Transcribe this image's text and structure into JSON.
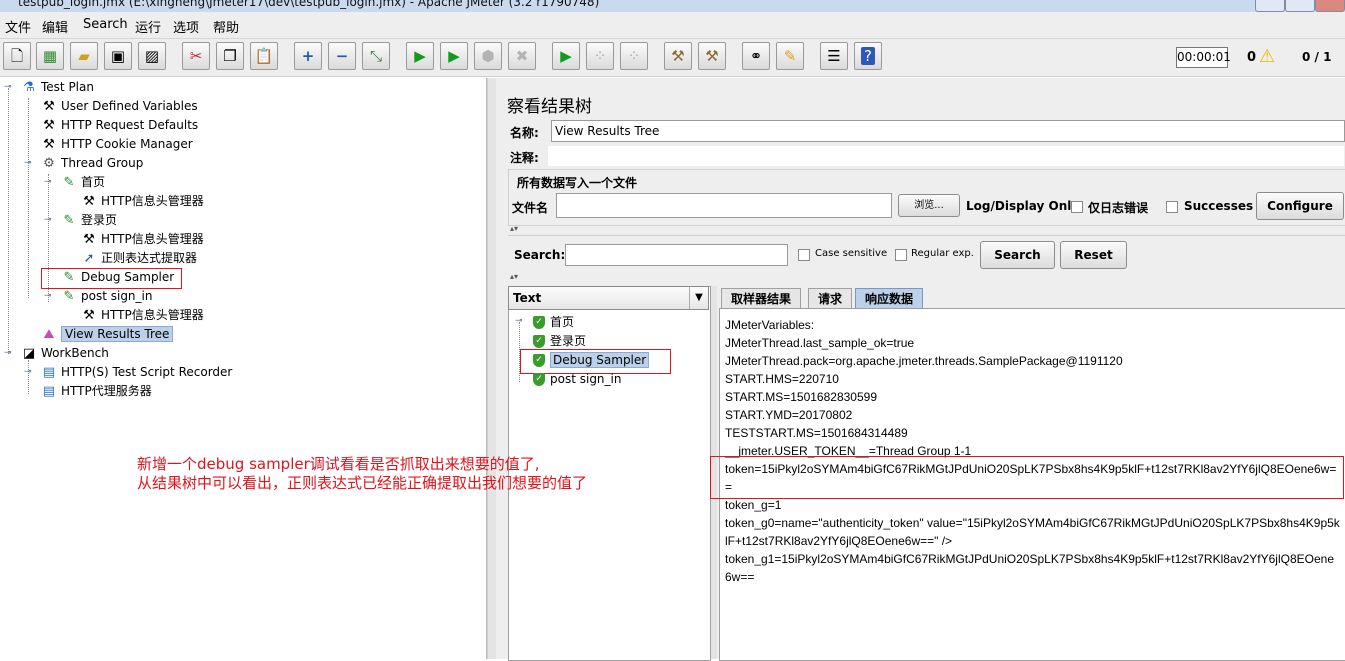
{
  "window": {
    "title": "testpub_login.jmx (E:\\xingneng\\Jmeter17\\dev\\testpub_login.jmx) - Apache JMeter (3.2 r1790748)"
  },
  "menu": [
    "文件",
    "编辑",
    "Search",
    "运行",
    "选项",
    "帮助"
  ],
  "toolbar": {
    "timer": "00:00:01",
    "warning_count": "0",
    "thread_ratio": "0 / 1"
  },
  "tree": [
    {
      "label": "Test Plan",
      "icon": "test-plan-icon"
    },
    {
      "label": "User Defined Variables",
      "icon": "wrench-icon"
    },
    {
      "label": "HTTP Request Defaults",
      "icon": "wrench-icon"
    },
    {
      "label": "HTTP Cookie Manager",
      "icon": "wrench-icon"
    },
    {
      "label": "Thread Group",
      "icon": "gear-icon"
    },
    {
      "label": "首页",
      "icon": "pipette-icon"
    },
    {
      "label": "HTTP信息头管理器",
      "icon": "wrench-icon"
    },
    {
      "label": "登录页",
      "icon": "pipette-icon"
    },
    {
      "label": "HTTP信息头管理器",
      "icon": "wrench-icon"
    },
    {
      "label": "正则表达式提取器",
      "icon": "extractor-icon"
    },
    {
      "label": "Debug Sampler",
      "icon": "pipette-icon"
    },
    {
      "label": "post sign_in",
      "icon": "pipette-icon"
    },
    {
      "label": "HTTP信息头管理器",
      "icon": "wrench-icon"
    },
    {
      "label": "View Results Tree",
      "icon": "chart-icon"
    },
    {
      "label": "WorkBench",
      "icon": "workbench-icon"
    },
    {
      "label": "HTTP(S) Test Script Recorder",
      "icon": "recorder-icon"
    },
    {
      "label": "HTTP代理服务器",
      "icon": "recorder-icon"
    }
  ],
  "panel": {
    "title": "察看结果树",
    "name_label": "名称:",
    "name_value": "View Results Tree",
    "comment_label": "注释:",
    "comment_value": "",
    "file_section_title": "所有数据写入一个文件",
    "filename_label": "文件名",
    "filename_value": "",
    "browse_button": "浏览...",
    "log_display_label": "Log/Display Only:",
    "errors_only_label": "仅日志错误",
    "successes_label": "Successes",
    "configure_button": "Configure",
    "search_label": "Search:",
    "search_value": "",
    "case_sensitive_label": "Case sensitive",
    "regular_exp_label": "Regular exp.",
    "search_button": "Search",
    "reset_button": "Reset",
    "renderer": "Text"
  },
  "results": [
    "首页",
    "登录页",
    "Debug Sampler",
    "post sign_in"
  ],
  "tabs": [
    "取样器结果",
    "请求",
    "响应数据"
  ],
  "response_lines": [
    "JMeterVariables:",
    "JMeterThread.last_sample_ok=true",
    "JMeterThread.pack=org.apache.jmeter.threads.SamplePackage@1191120",
    "START.HMS=220710",
    "START.MS=1501682830599",
    "START.YMD=20170802",
    "TESTSTART.MS=1501684314489",
    "__jmeter.USER_TOKEN__=Thread Group 1-1",
    "token=15iPkyl2oSYMAm4biGfC67RikMGtJPdUniO20SpLK7PSbx8hs4K9p5klF+t12st7RKl8av2YfY6jlQ8EOene6w==",
    "token_g=1",
    "token_g0=name=\"authenticity_token\" value=\"15iPkyl2oSYMAm4biGfC67RikMGtJPdUniO20SpLK7PSbx8hs4K9p5klF+t12st7RKl8av2YfY6jlQ8EOene6w==\" />",
    "token_g1=15iPkyl2oSYMAm4biGfC67RikMGtJPdUniO20SpLK7PSbx8hs4K9p5klF+t12st7RKl8av2YfY6jlQ8EOene6w=="
  ],
  "annotation": {
    "line1": "新增一个debug sampler调试看看是否抓取出来想要的值了,",
    "line2": "从结果树中可以看出，正则表达式已经能正确提取出我们想要的值了"
  },
  "colors": {
    "selection": "#bcd0ea",
    "highlight_box": "#e0141c",
    "annotation_text": "#e0141c"
  }
}
